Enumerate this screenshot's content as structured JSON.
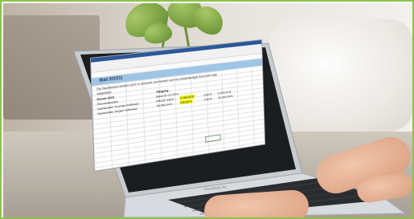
{
  "spreadsheet": {
    "sheet_title": "Blatt 2015/11",
    "intro": "Die Sachkosten werden mit 5 % vermerkt und werden sich im Gesamtbudget durch wie folgt",
    "intro2": "aufgelistet:",
    "col_header": "Tätigung",
    "header_label": "Dienst 2015",
    "rows": [
      {
        "label": "Personalkosten",
        "v1": "Band 31.12.2014"
      },
      {
        "label": "Sachkosten Thomas Hoffmann",
        "v1": "PRO2F.1A/01",
        "v2": "5 000,00 €",
        "v3": "5,00 €",
        "v4": "5 000,00 €"
      },
      {
        "label": "Sachkosten Jürgen Hoffmann",
        "v1": "45 060,44 €",
        "v2": "PRO2F4",
        "v3": "5,00 €",
        "v4": "45 000,00 €"
      }
    ]
  },
  "laptop_brand": "MacBook Air",
  "colors": {
    "frame": "#8bc34a",
    "highlight": "#f2f20a",
    "sheet_header": "#9ec5e6"
  }
}
